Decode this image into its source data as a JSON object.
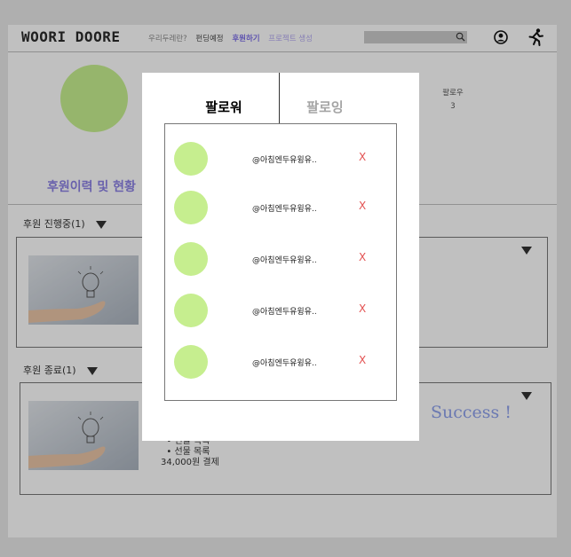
{
  "header": {
    "logo": "WOORI DOORE",
    "nav": [
      "우리두레란?",
      "펀딩예정",
      "후원하기",
      "프로젝트 생성"
    ]
  },
  "profile": {
    "follower_label": "팔로우",
    "follower_count": "3"
  },
  "history": {
    "title": "후원이력 및 현황",
    "ongoing_label": "후원 진행중(1)",
    "ended_label": "후원 종료(1)",
    "ended_items": [
      "선물 목록",
      "선물 목록"
    ],
    "ended_payment": "34,000원 결제",
    "ended_status": "Success !"
  },
  "modal": {
    "tab_follower": "팔로워",
    "tab_following": "팔로잉",
    "followers": [
      {
        "name": "@아침엔두유윙유..",
        "remove": "X"
      },
      {
        "name": "@아침엔두유윙유..",
        "remove": "X"
      },
      {
        "name": "@아침엔두유윙유..",
        "remove": "X"
      },
      {
        "name": "@아침엔두유윙유..",
        "remove": "X"
      },
      {
        "name": "@아침엔두유윙유..",
        "remove": "X"
      }
    ]
  },
  "colors": {
    "accent": "#7d6fe6",
    "avatar": "#c6ee8f",
    "remove": "#e35151"
  },
  "icons": [
    "search-icon",
    "user-icon",
    "running-person-icon",
    "lightbulb-icon",
    "dropdown-arrow-icon"
  ]
}
